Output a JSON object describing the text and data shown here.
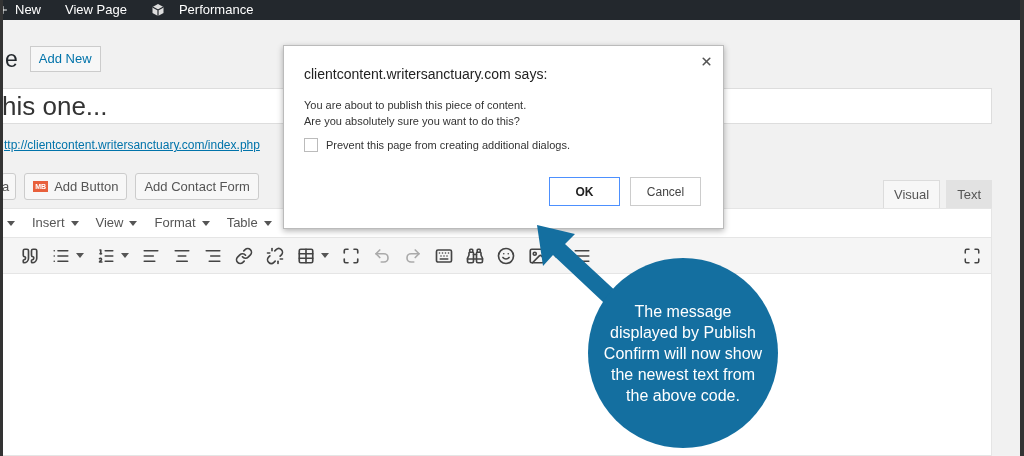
{
  "top_bar": {
    "items": [
      {
        "kind": "new",
        "label": "New"
      },
      {
        "kind": "link",
        "label": "View Page"
      },
      {
        "kind": "plugin",
        "label": "Performance"
      }
    ]
  },
  "heading": {
    "title": "e",
    "add_new": "Add New"
  },
  "title_field": {
    "value": "his one..."
  },
  "permalink": "ttp://clientcontent.writersanctuary.com/index.php",
  "media_buttons": [
    {
      "kind": "plain",
      "label": "a"
    },
    {
      "kind": "icon",
      "label": "Add Button",
      "icon": "MB"
    },
    {
      "kind": "plain",
      "label": "Add Contact Form"
    }
  ],
  "editor_tabs": [
    {
      "label": "Visual",
      "selected": true
    },
    {
      "label": "Text",
      "selected": false
    }
  ],
  "menubar": [
    {
      "label": "Insert"
    },
    {
      "label": "View"
    },
    {
      "label": "Format"
    },
    {
      "label": "Table"
    }
  ],
  "dialog": {
    "origin": "clientcontent.writersanctuary.com says:",
    "message": [
      "You are about to publish this piece of content.",
      "Are you absolutely sure you want to do this?"
    ],
    "checkbox": {
      "label": "Prevent this page from creating additional dialogs.",
      "checked": false
    },
    "buttons": [
      {
        "label": "OK",
        "default": true
      },
      {
        "label": "Cancel",
        "default": false
      }
    ]
  },
  "callout": {
    "text": "The message displayed by Publish Confirm will now show the newest text from the above code."
  }
}
